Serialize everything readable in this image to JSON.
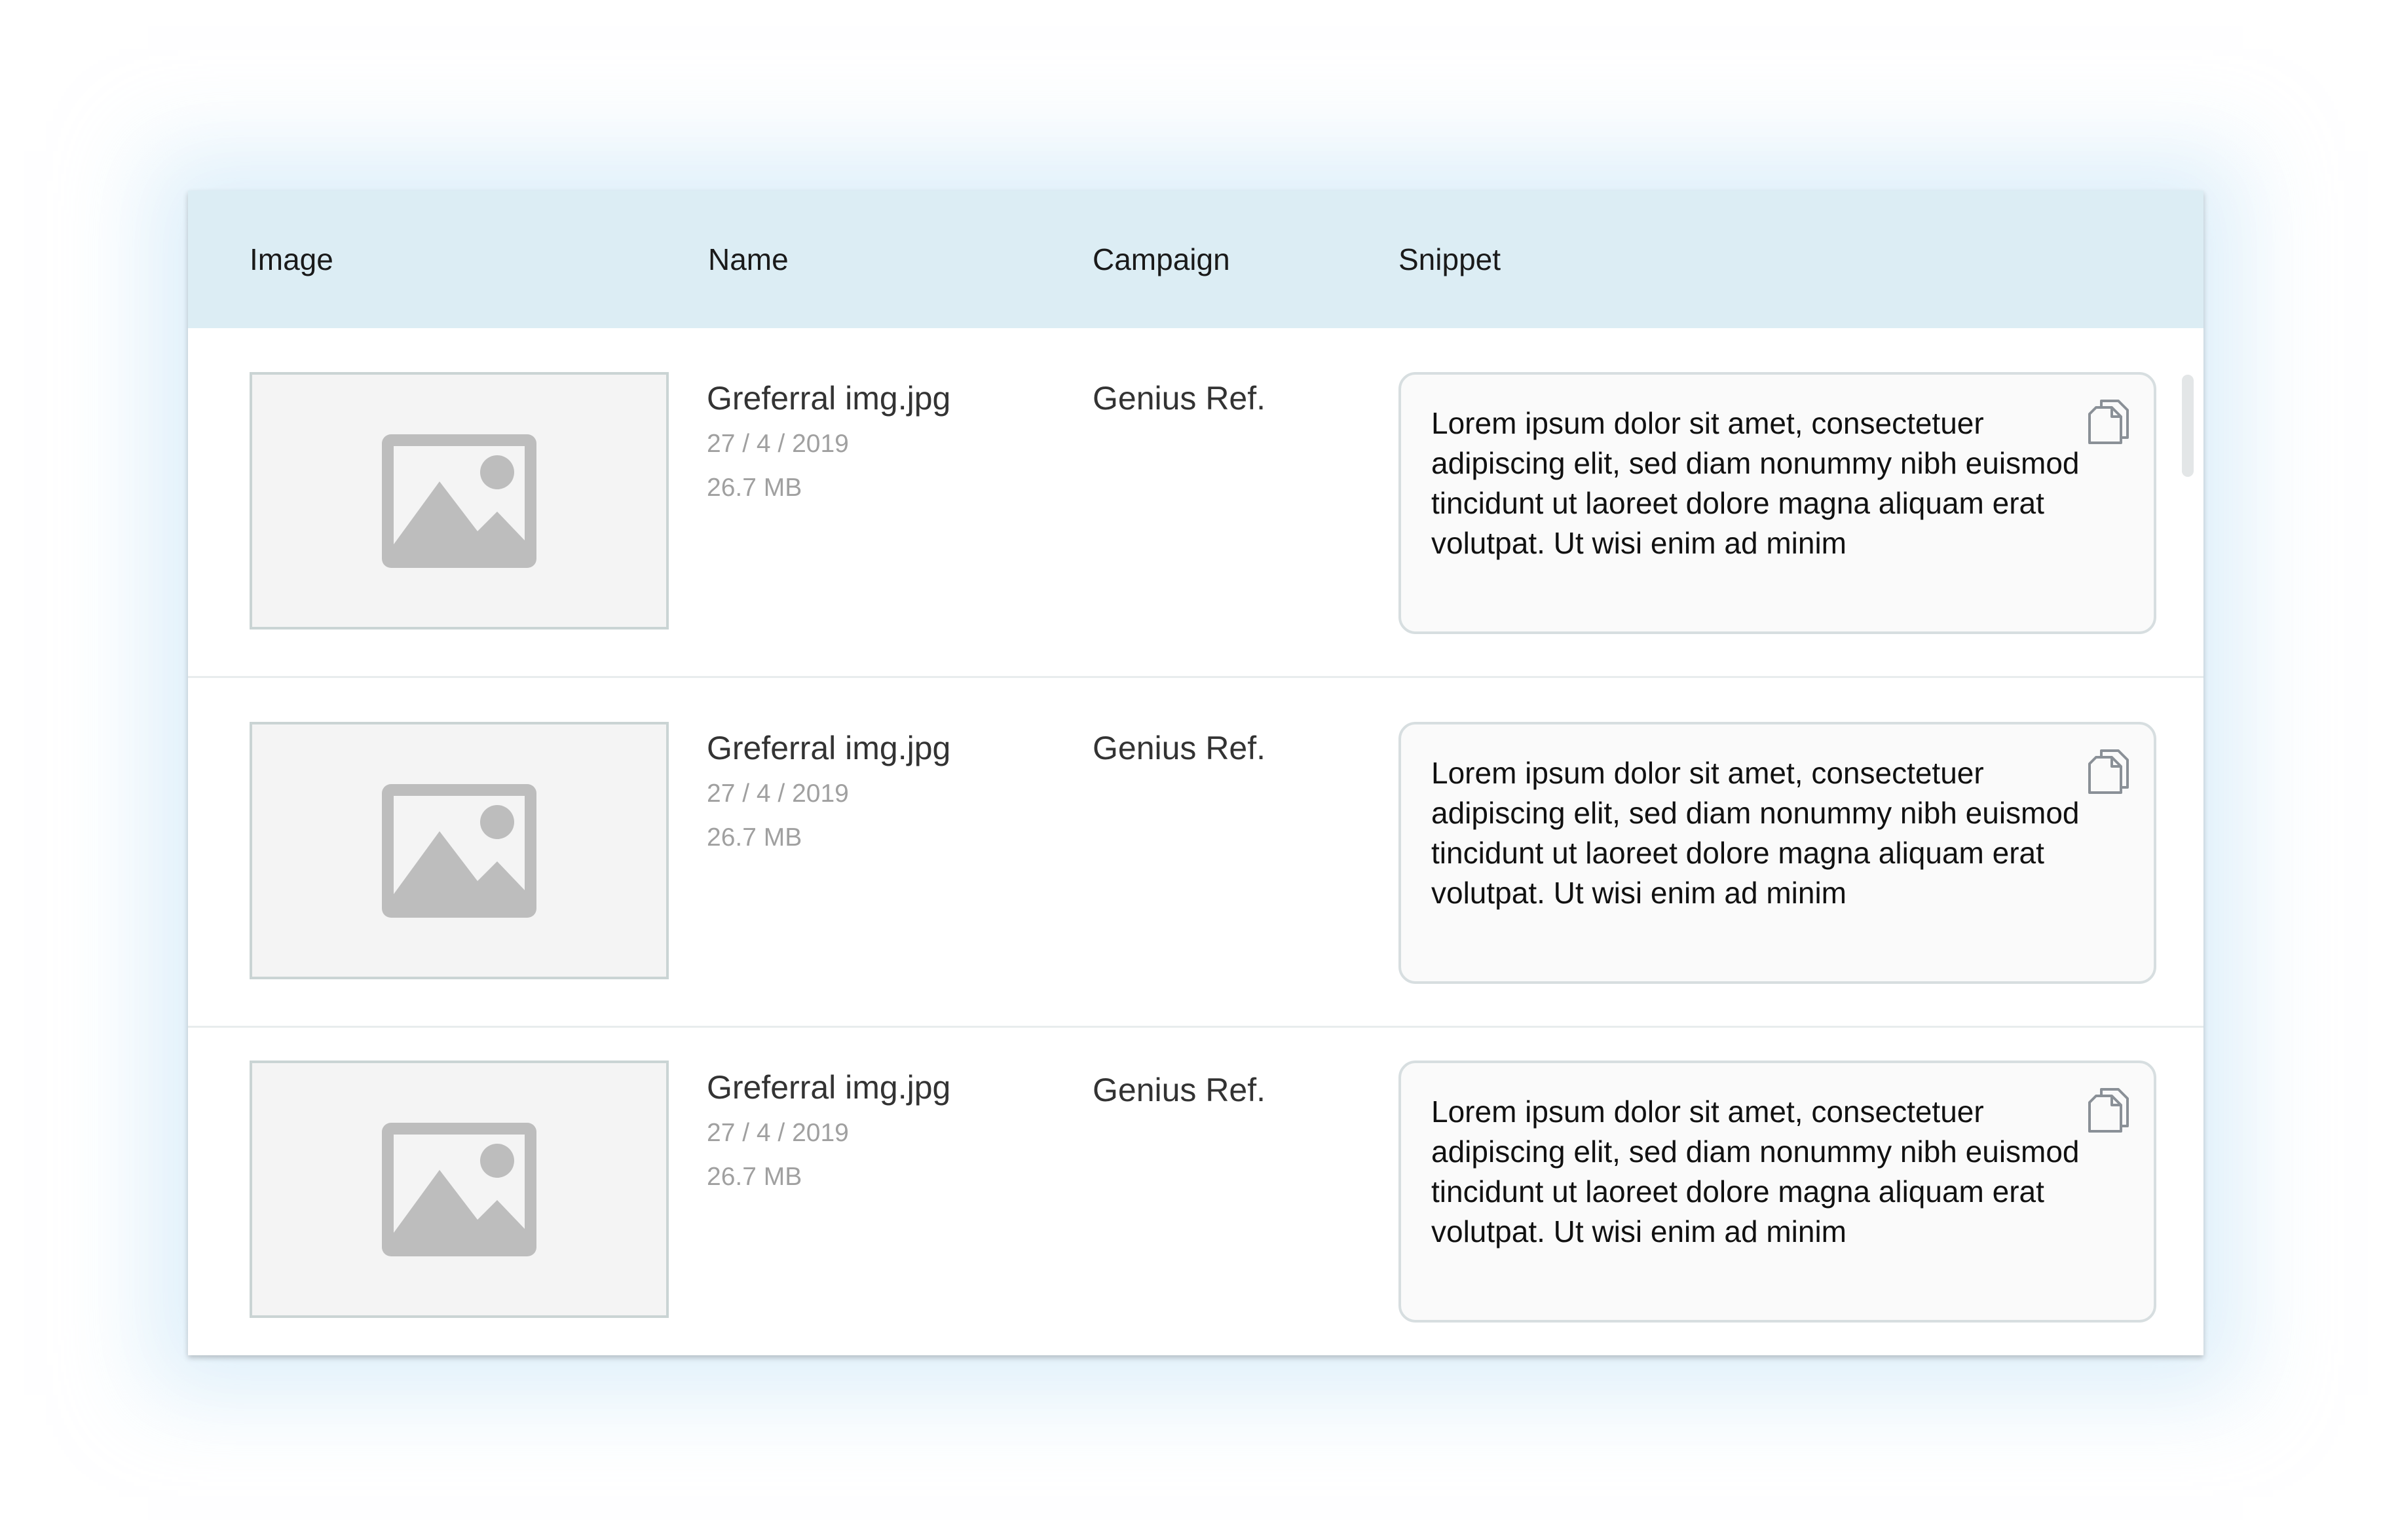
{
  "table": {
    "columns": [
      "Image",
      "Name",
      "Campaign",
      "Snippet"
    ],
    "rows": [
      {
        "image_icon": "image-placeholder-icon",
        "name": "Greferral img.jpg",
        "date": "27 / 4 / 2019",
        "size": "26.7 MB",
        "campaign": "Genius Ref.",
        "snippet": "Lorem ipsum dolor sit amet, consectetuer adipiscing elit, sed diam nonummy nibh euismod tincidunt ut laoreet dolore magna aliquam erat volutpat. Ut wisi enim ad minim",
        "copy_icon": "copy-icon"
      },
      {
        "image_icon": "image-placeholder-icon",
        "name": "Greferral img.jpg",
        "date": "27 / 4 / 2019",
        "size": "26.7 MB",
        "campaign": "Genius Ref.",
        "snippet": "Lorem ipsum dolor sit amet, consectetuer adipiscing elit, sed diam nonummy nibh euismod tincidunt ut laoreet dolore magna aliquam erat volutpat. Ut wisi enim ad minim",
        "copy_icon": "copy-icon"
      },
      {
        "image_icon": "image-placeholder-icon",
        "name": "Greferral img.jpg",
        "date": "27 / 4 / 2019",
        "size": "26.7 MB",
        "campaign": "Genius Ref.",
        "snippet": "Lorem ipsum dolor sit amet, consectetuer adipiscing elit, sed diam nonummy nibh euismod tincidunt ut laoreet dolore magna aliquam erat volutpat. Ut wisi enim ad minim",
        "copy_icon": "copy-icon"
      }
    ]
  },
  "colors": {
    "header_background": "#dcedf4",
    "placeholder_fill": "#bdbdbd",
    "border": "#cad4d4"
  }
}
